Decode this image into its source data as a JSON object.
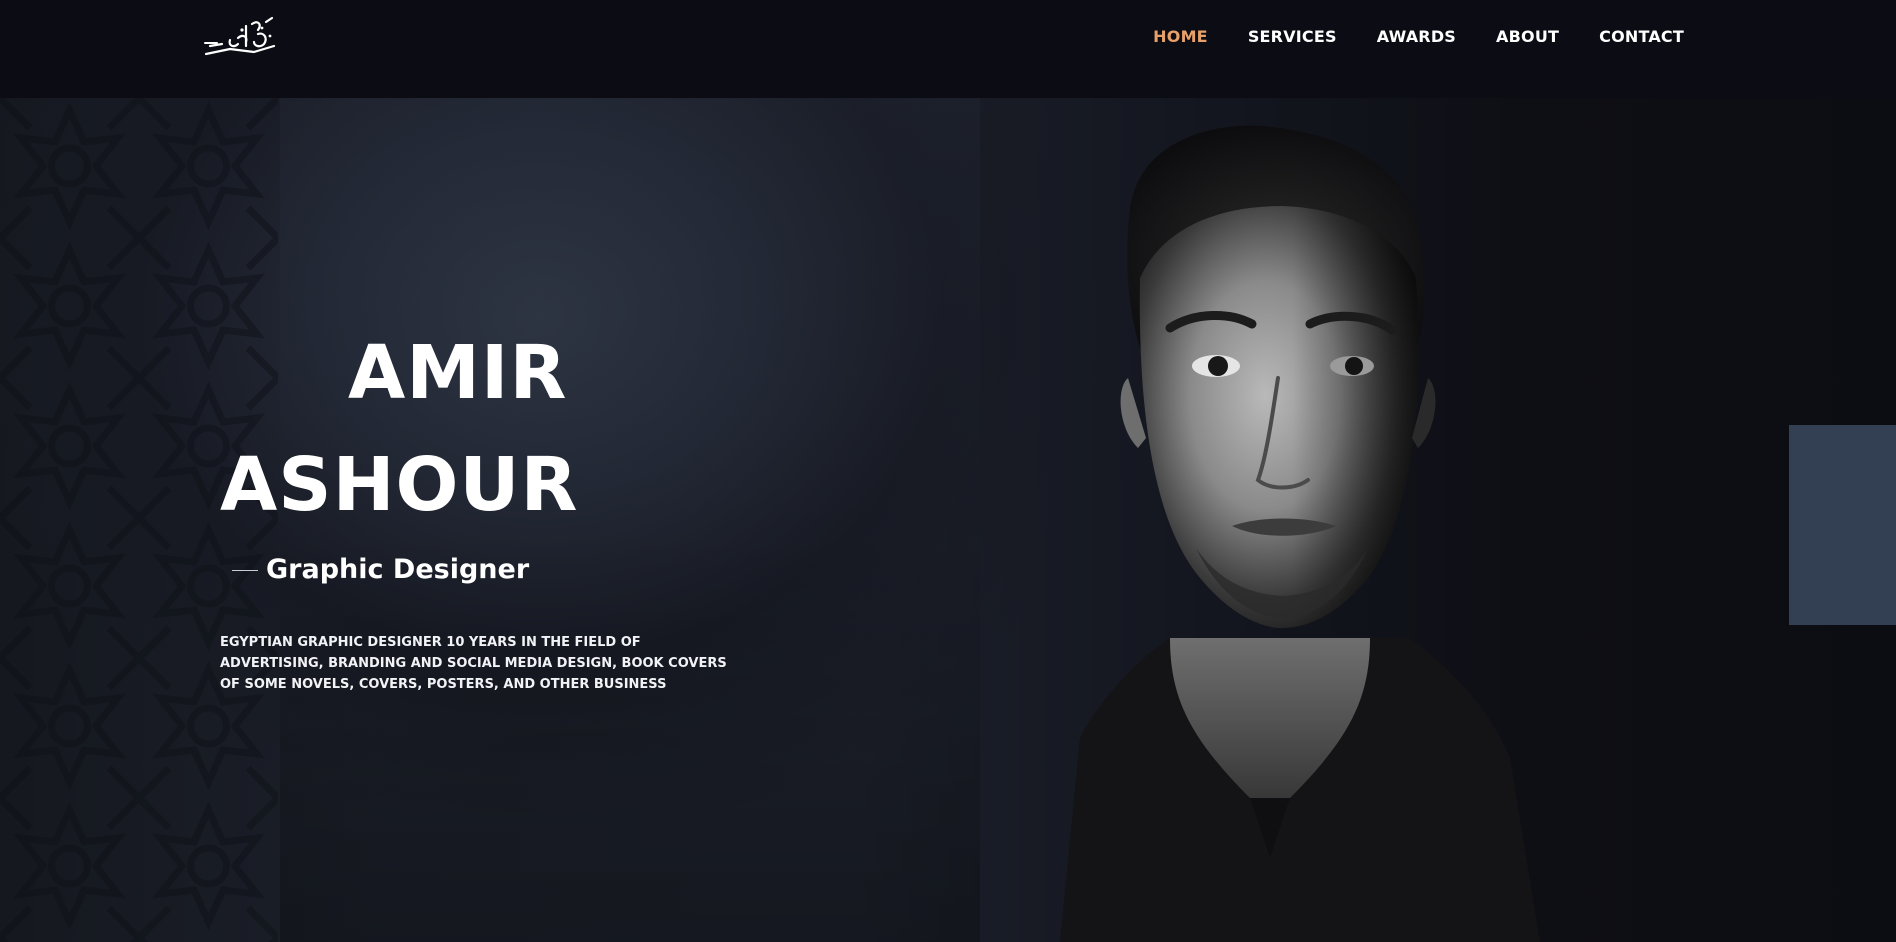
{
  "header": {
    "logo_alt": "Amir Ashour logo",
    "nav": [
      {
        "label": "HOME",
        "active": true
      },
      {
        "label": "SERVICES",
        "active": false
      },
      {
        "label": "AWARDS",
        "active": false
      },
      {
        "label": "ABOUT",
        "active": false
      },
      {
        "label": "CONTACT",
        "active": false
      }
    ]
  },
  "hero": {
    "name_line1": "AMIR",
    "name_line2": "ASHOUR",
    "role": "Graphic Designer",
    "bio": "EGYPTIAN GRAPHIC DESIGNER 10 YEARS IN THE FIELD OF ADVERTISING, BRANDING AND SOCIAL MEDIA DESIGN, BOOK COVERS OF SOME NOVELS, COVERS, POSTERS, AND OTHER BUSINESS"
  },
  "colors": {
    "accent": "#e8a06a",
    "background": "#0d0e14",
    "side_panel": "#334054",
    "text": "#ffffff"
  },
  "icons": {
    "logo": "calligraphy-logo-icon"
  }
}
